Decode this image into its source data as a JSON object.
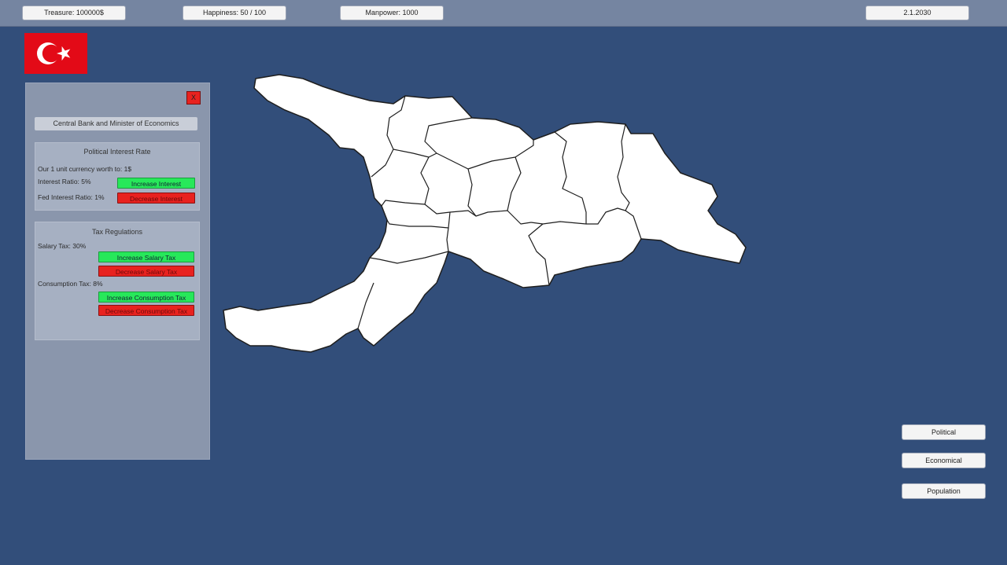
{
  "topbar": {
    "treasure": "Treasure: 100000$",
    "happiness": "Happiness: 50 / 100",
    "manpower": "Manpower: 1000",
    "date": "2.1.2030"
  },
  "flag": {
    "colors": {
      "field": "#e30a17",
      "emblem": "#ffffff"
    }
  },
  "panel": {
    "close_label": "X",
    "title": "Central Bank and Minister of Economics",
    "interest": {
      "title": "Political Interest Rate",
      "currency_worth": "Our 1 unit currency worth to: 1$",
      "interest_ratio": "Interest Ratio: 5%",
      "fed_interest_ratio": "Fed Interest Ratio: 1%",
      "increase_label": "Increase Interest",
      "decrease_label": "Decrease Interest"
    },
    "tax": {
      "title": "Tax Regulations",
      "salary_tax": "Salary Tax: 30%",
      "increase_salary_label": "Increase Salary Tax",
      "decrease_salary_label": "Decrease Salary Tax",
      "consumption_tax": "Consumption Tax: 8%",
      "increase_consumption_label": "Increase Consumption Tax",
      "decrease_consumption_label": "Decrease Consumption Tax"
    }
  },
  "map_modes": {
    "political": "Political",
    "economical": "Economical",
    "population": "Population"
  },
  "colors": {
    "background": "#324e7a",
    "topbar": "#7585a1",
    "panel": "#8a96ac",
    "button_green": "#27e85a",
    "button_red": "#e8221f",
    "map_land": "#ffffff",
    "map_border": "#1e1e1e"
  }
}
